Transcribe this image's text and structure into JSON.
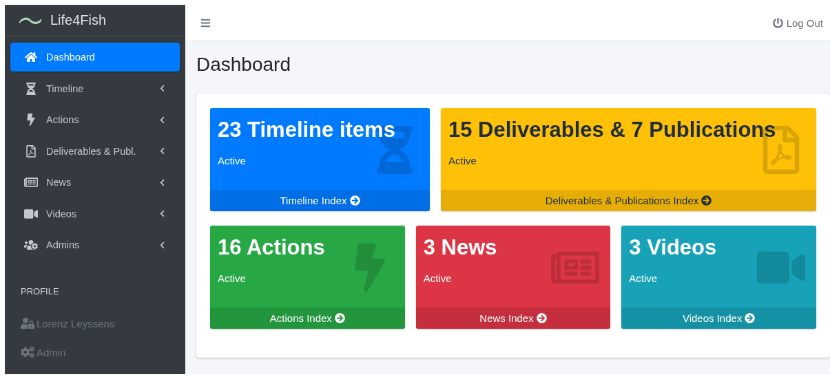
{
  "brand": {
    "name": "Life4Fish"
  },
  "sidebar": {
    "items": [
      {
        "kind": "home",
        "label": "Dashboard",
        "selected": true,
        "submenu": false
      },
      {
        "kind": "hourglass",
        "label": "Timeline",
        "selected": false,
        "submenu": true
      },
      {
        "kind": "bolt",
        "label": "Actions",
        "selected": false,
        "submenu": true
      },
      {
        "kind": "pdf",
        "label": "Deliverables & Publ.",
        "selected": false,
        "submenu": true
      },
      {
        "kind": "news",
        "label": "News",
        "selected": false,
        "submenu": true
      },
      {
        "kind": "video",
        "label": "Videos",
        "selected": false,
        "submenu": true
      },
      {
        "kind": "users-cog",
        "label": "Admins",
        "selected": false,
        "submenu": true
      }
    ],
    "section_header": "PROFILE",
    "profile_items": [
      {
        "kind": "user-lock",
        "label": "Lorenz Leyssens",
        "disabled": true
      },
      {
        "kind": "cogs",
        "label": "Admin",
        "disabled": true
      }
    ]
  },
  "topbar": {
    "logout": "Log Out"
  },
  "page_title": "Dashboard",
  "rows": [
    [
      {
        "kind": "hourglass",
        "title": "23 Timeline items",
        "status": "Active",
        "link": "Timeline Index",
        "color": "#007bff",
        "dark_text": false
      },
      {
        "kind": "pdf",
        "title": "15 Deliverables & 7 Publications",
        "status": "Active",
        "link": "Deliverables & Publications Index",
        "color": "#ffc107",
        "dark_text": true
      }
    ],
    [
      {
        "kind": "bolt",
        "title": "16 Actions",
        "status": "Active",
        "link": "Actions Index",
        "color": "#28a745",
        "dark_text": false
      },
      {
        "kind": "news",
        "title": "3 News",
        "status": "Active",
        "link": "News Index",
        "color": "#dc3545",
        "dark_text": false
      },
      {
        "kind": "video",
        "title": "3 Videos",
        "status": "Active",
        "link": "Videos Index",
        "color": "#17a2b8",
        "dark_text": false
      }
    ]
  ]
}
